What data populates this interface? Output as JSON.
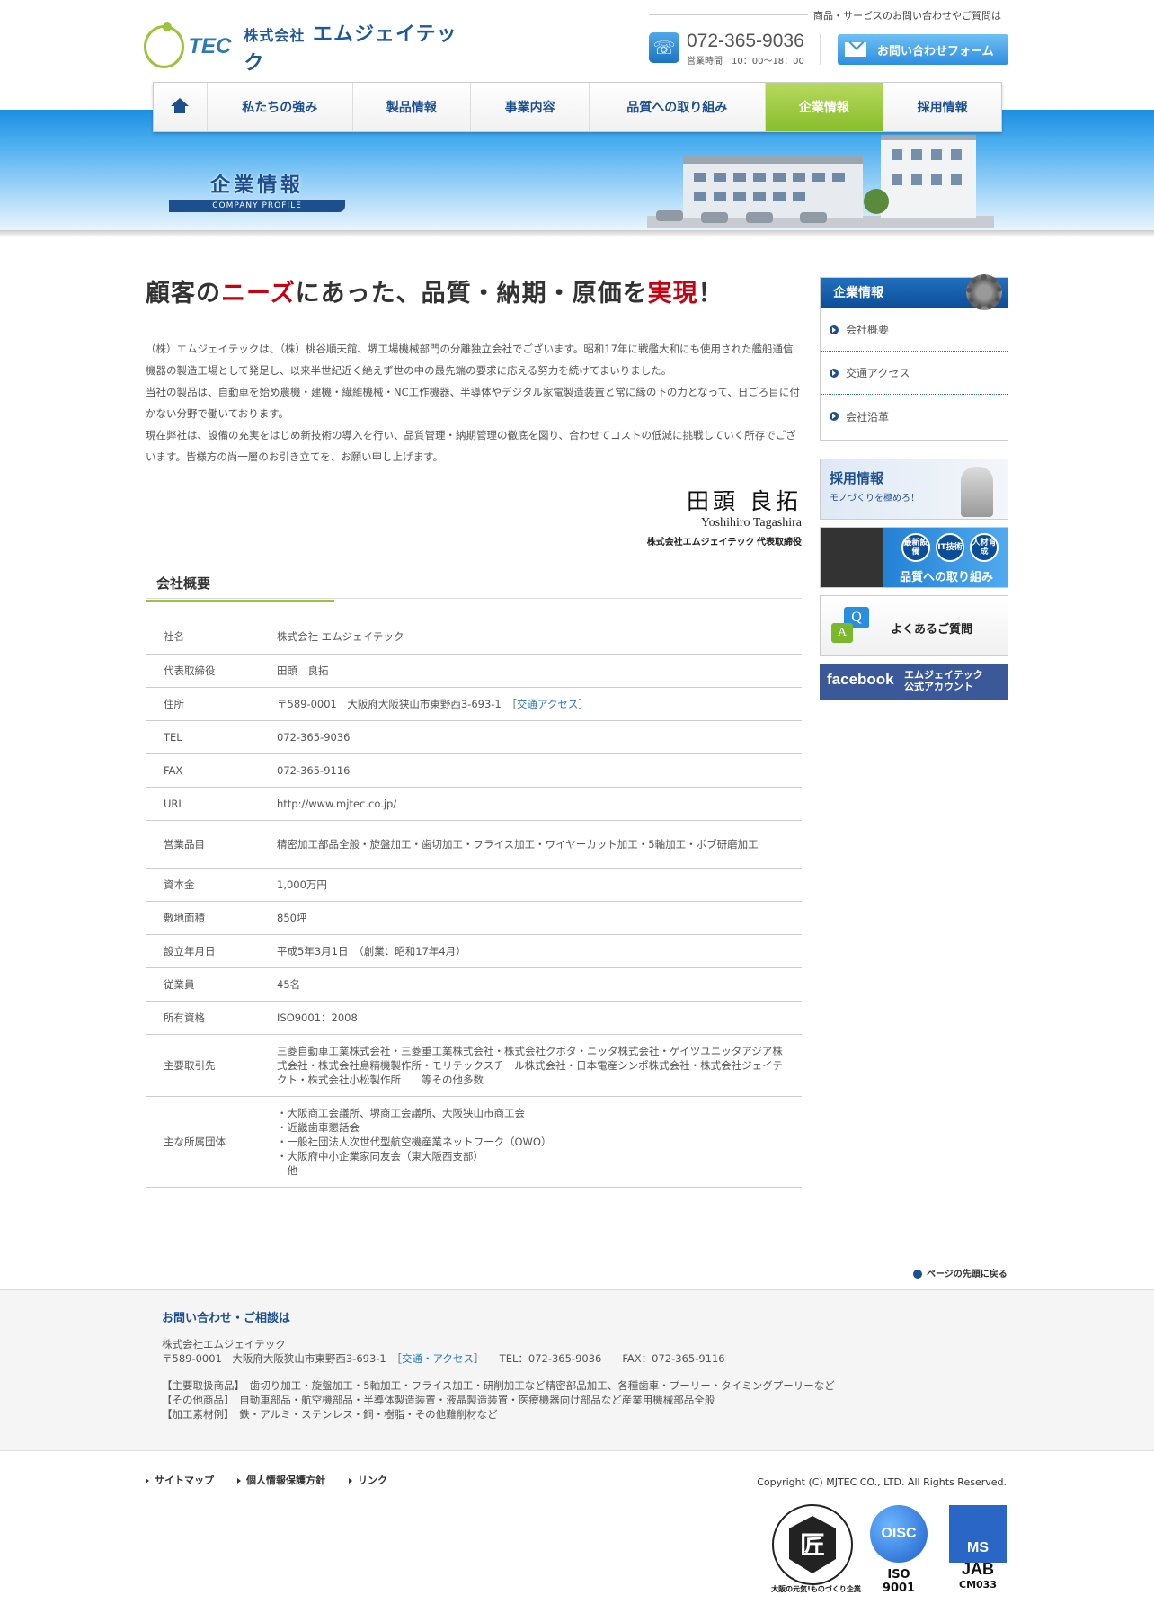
{
  "header": {
    "logo_tec": "TEC",
    "logo_company_prefix": "株式会社",
    "logo_company_name": "エムジェイテック",
    "contact_note": "商品・サービスのお問い合わせやご質問は",
    "tel": "072-365-9036",
    "hours": "営業時間　10：00〜18：00",
    "contact_button": "お問い合わせフォーム"
  },
  "nav": {
    "items": [
      {
        "label": "私たちの強み"
      },
      {
        "label": "製品情報"
      },
      {
        "label": "事業内容"
      },
      {
        "label": "品質への取り組み"
      },
      {
        "label": "企業情報"
      },
      {
        "label": "採用情報"
      }
    ],
    "active": "企業情報",
    "active_color": "#88bd2b"
  },
  "banner": {
    "title_jp": "企業情報",
    "title_en": "COMPANY PROFILE"
  },
  "main": {
    "headline_parts": [
      "顧客の",
      "ニーズ",
      "にあった、品質・納期・原価を",
      "実現",
      "！"
    ],
    "intro": [
      "（株）エムジェイテックは、（株）桃谷順天館、堺工場機械部門の分離独立会社でございます。昭和17年に戦艦大和にも使用された艦船通信機器の製造工場として発足し、以来半世紀近く絶えず世の中の最先端の要求に応える努力を続けてまいりました。",
      "当社の製品は、自動車を始め農機・建機・繊維機械・NC工作機器、半導体やデジタル家電製造装置と常に縁の下の力となって、日ごろ目に付かない分野で働いております。",
      "現在弊社は、設備の充実をはじめ新技術の導入を行い、品質管理・納期管理の徹底を図り、合わせてコストの低減に挑戦していく所存でございます。皆様方の尚一層のお引き立てを、お願い申し上げます。"
    ],
    "signature_jp": "田頭 良拓",
    "signature_en": "Yoshihiro Tagashira",
    "signature_title": "株式会社エムジェイテック 代表取締役",
    "section_title": "会社概要",
    "table": {
      "name_label": "社名",
      "name": "株式会社 エムジェイテック",
      "rep_label": "代表取締役",
      "rep": "田頭　良拓",
      "addr_label": "住所",
      "addr": "〒589-0001　大阪府大阪狭山市東野西3-693-1　［",
      "addr_link": "交通アクセス",
      "addr_end": "］",
      "tel_label": "TEL",
      "tel": "072-365-9036",
      "fax_label": "FAX",
      "fax": "072-365-9116",
      "url_label": "URL",
      "url": "http://www.mjtec.co.jp/",
      "items_label": "営業品目",
      "items": "精密加工部品全般・旋盤加工・歯切加工・フライス加工・ワイヤーカット加工・5軸加工・ボブ研磨加工",
      "capital_label": "資本金",
      "capital": "1,000万円",
      "area_label": "敷地面積",
      "area": "850坪",
      "founded_label": "設立年月日",
      "founded": "平成5年3月1日　（創業：昭和17年4月）",
      "staff_label": "従業員",
      "staff": "45名",
      "cert_label": "所有資格",
      "cert": "ISO9001：2008",
      "clients_label": "主要取引先",
      "clients": "三菱自動車工業株式会社・三菱重工業株式会社・株式会社クボタ・ニッタ株式会社・ゲイツユニッタアジア株式会社・株式会社島精機製作所・モリテックスチール株式会社・日本電産シンポ株式会社・株式会社ジェイテクト・株式会社小松製作所　　等その他多数",
      "groups_label": "主な所属団体",
      "groups": [
        "・大阪商工会議所、堺商工会議所、大阪狭山市商工会",
        "・近畿歯車懇話会",
        "・一般社団法人次世代型航空機産業ネットワーク（OWO）",
        "・大阪府中小企業家同友会（東大阪西支部）",
        "　他"
      ]
    }
  },
  "sidebar": {
    "title": "企業情報",
    "links": [
      "会社概要",
      "交通アクセス",
      "会社沿革"
    ],
    "recruit_title": "採用情報",
    "recruit_sub": "モノづくりを極めろ！",
    "quality_circles": [
      "最新設備",
      "IT技術",
      "人材育成"
    ],
    "quality_title": "品質への取り組み",
    "faq_q": "Q",
    "faq_a": "A",
    "faq": "よくあるご質問",
    "fb_logo": "facebook",
    "fb_text1": "エムジェイテック",
    "fb_text2": "公式アカウント"
  },
  "pagetop": "ページの先頭に戻る",
  "footer": {
    "title": "お問い合わせ・ご相談は",
    "company": "株式会社エムジェイテック",
    "addr": "〒589-0001　大阪府大阪狭山市東野西3-693-1　［",
    "addr_link": "交通・アクセス",
    "addr_rest": "］　　TEL：072-365-9036　　FAX：072-365-9116",
    "line1": "【主要取扱商品】　歯切り加工・旋盤加工・5軸加工・フライス加工・研削加工など精密部品加工、各種歯車・プーリー・タイミングプーリーなど",
    "line2": "【その他商品】　自動車部品・航空機部品・半導体製造装置・液晶製造装置・医療機器向け部品など産業用機械部品全般",
    "line3": "【加工素材例】　鉄・アルミ・ステンレス・銅・樹脂・その他難削材など",
    "links": [
      "サイトマップ",
      "個人情報保護方針",
      "リンク"
    ],
    "copyright": "Copyright (C) MJTEC CO., LTD. All Rights Reserved.",
    "cert1_caption": "大阪の元気!ものづくり企業",
    "cert1_mark": "匠",
    "cert2": "OISC",
    "cert2_caption": "ISO 9001",
    "cert3": "MS",
    "cert3_caption": "JAB",
    "cert3_sub": "CM033"
  }
}
